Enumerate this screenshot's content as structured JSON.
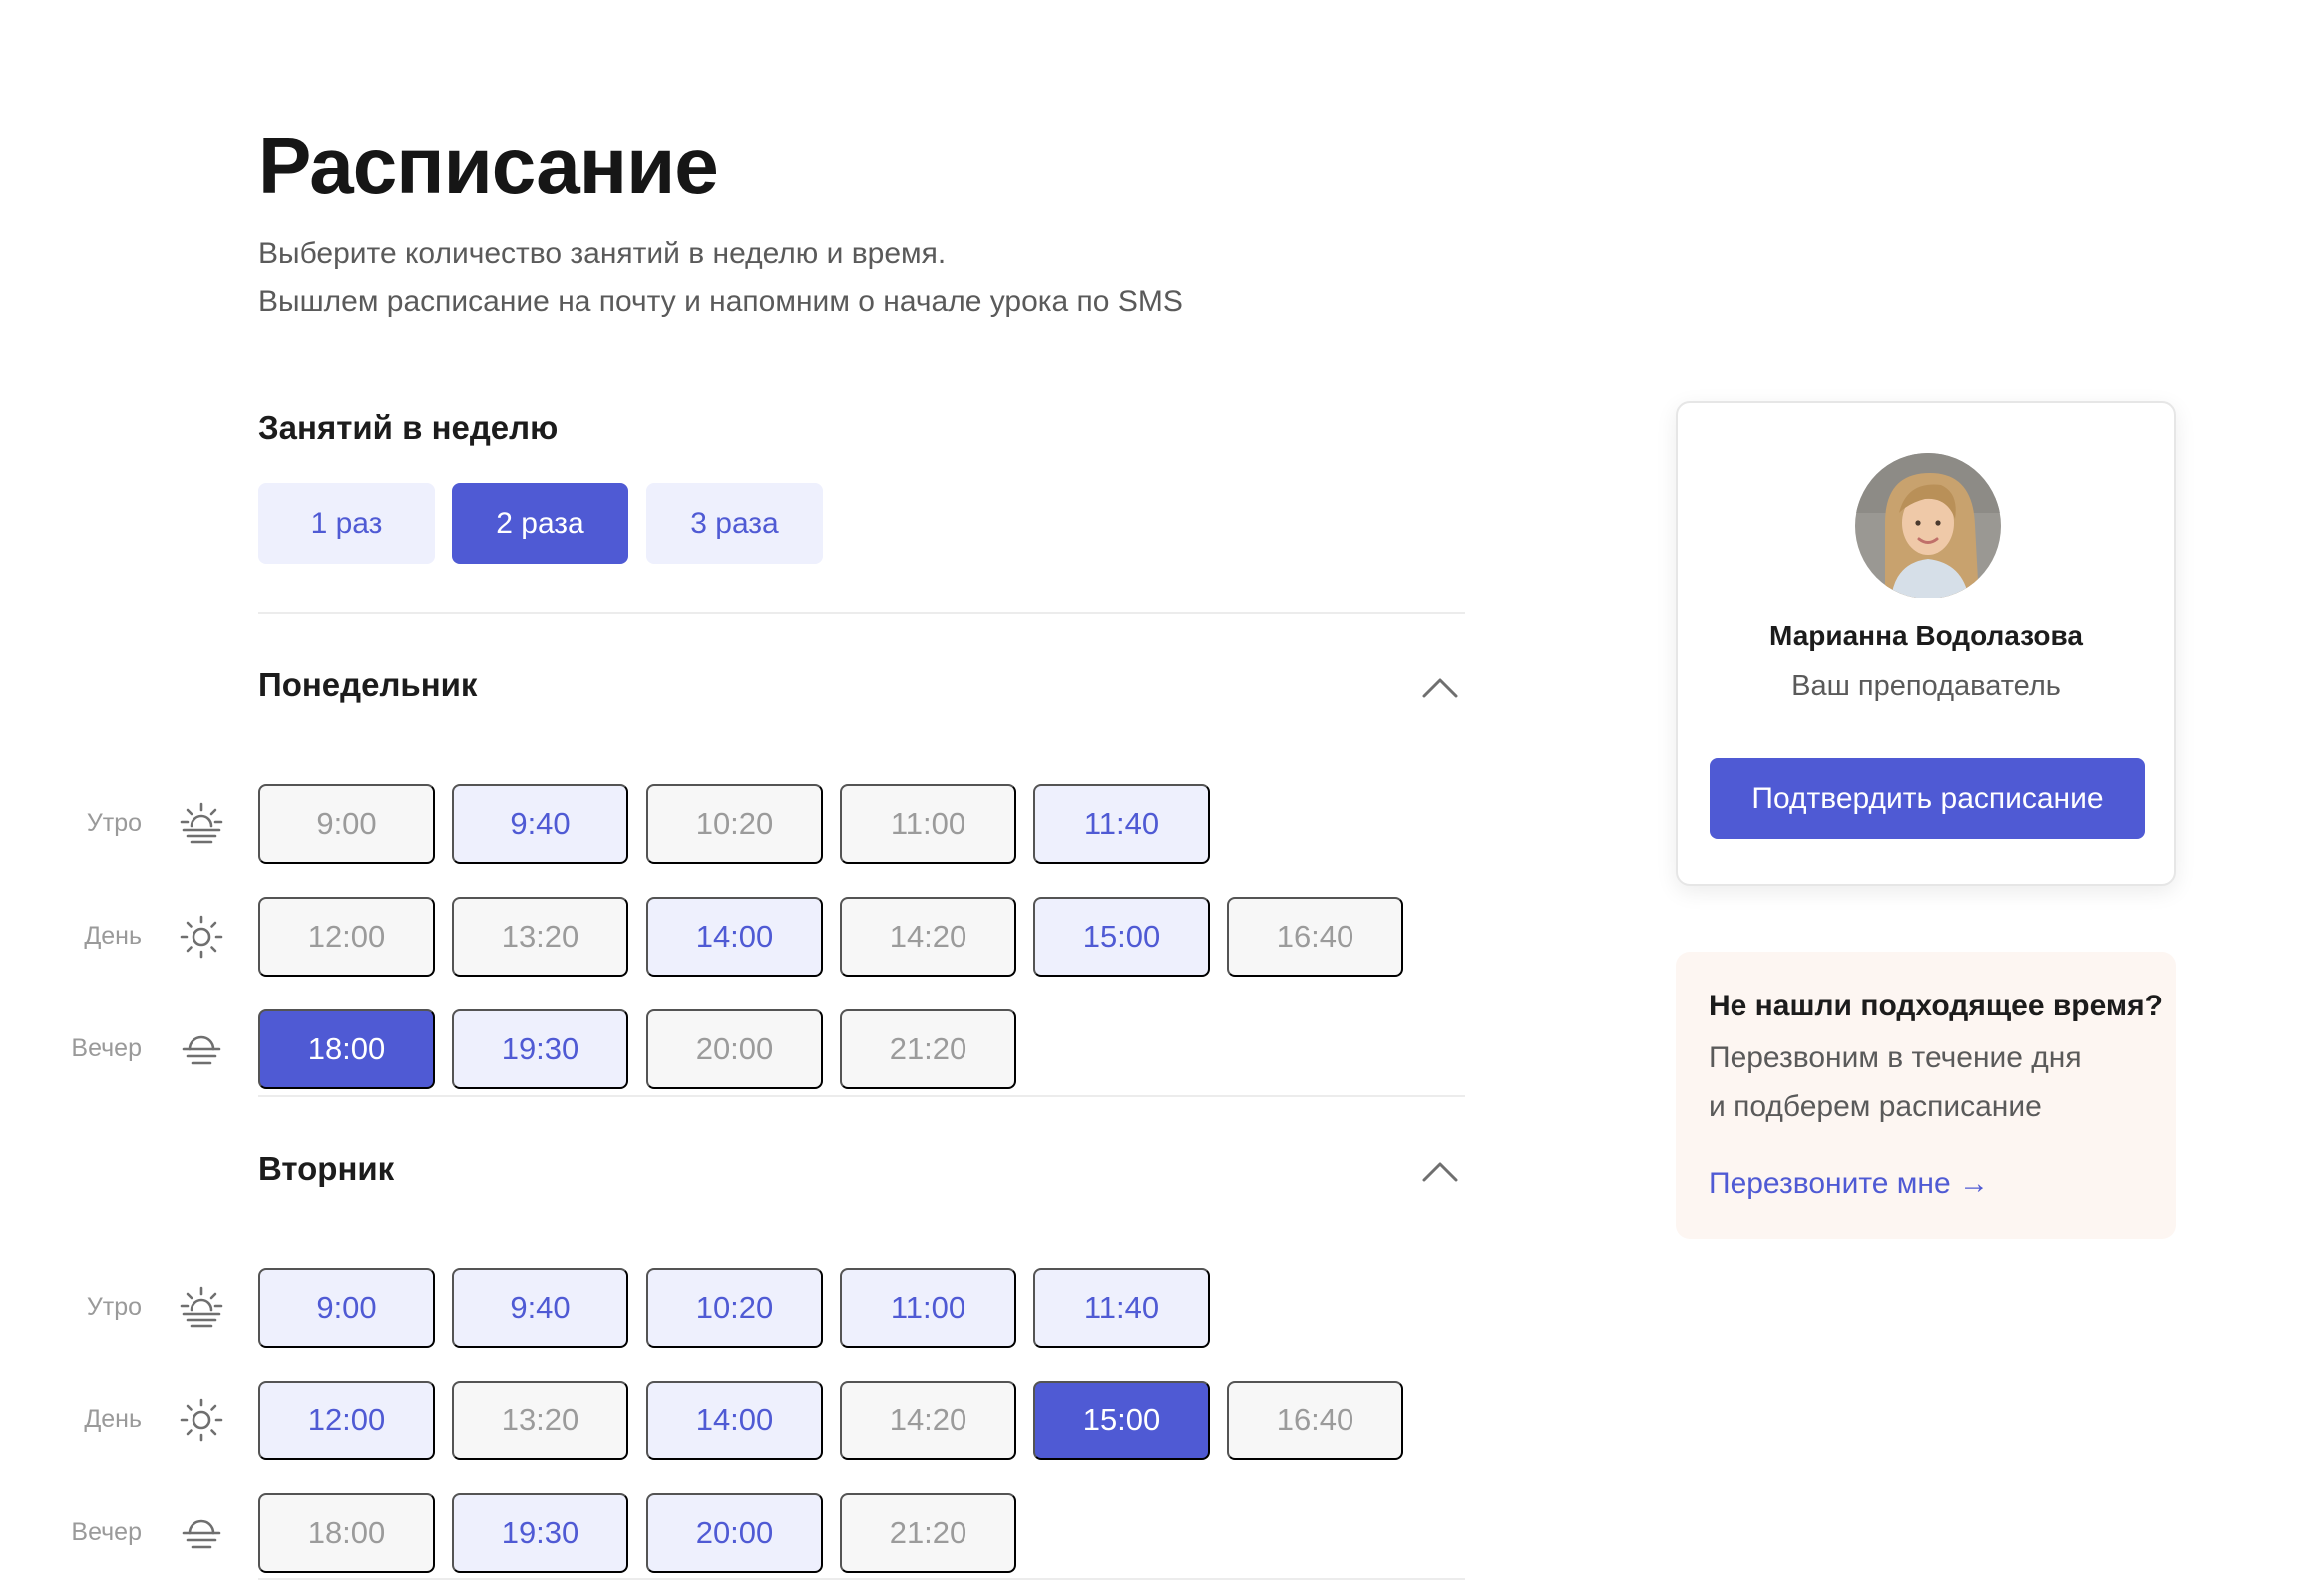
{
  "page": {
    "title": "Расписание",
    "subtitle_line1": "Выберите количество занятий в неделю и время.",
    "subtitle_line2": "Вышлем расписание на почту и напомним о начале урока по SMS"
  },
  "frequency": {
    "title": "Занятий в неделю",
    "options": [
      "1 раз",
      "2 раза",
      "3 раза"
    ],
    "selected": "2 раза"
  },
  "periods": {
    "morning": "Утро",
    "day": "День",
    "evening": "Вечер"
  },
  "days": [
    {
      "name": "Понедельник",
      "morning": [
        {
          "time": "9:00",
          "state": "na"
        },
        {
          "time": "9:40",
          "state": "av"
        },
        {
          "time": "10:20",
          "state": "na"
        },
        {
          "time": "11:00",
          "state": "na"
        },
        {
          "time": "11:40",
          "state": "av"
        }
      ],
      "day": [
        {
          "time": "12:00",
          "state": "na"
        },
        {
          "time": "13:20",
          "state": "na"
        },
        {
          "time": "14:00",
          "state": "av"
        },
        {
          "time": "14:20",
          "state": "na"
        },
        {
          "time": "15:00",
          "state": "av"
        },
        {
          "time": "16:40",
          "state": "na"
        }
      ],
      "evening": [
        {
          "time": "18:00",
          "state": "sel"
        },
        {
          "time": "19:30",
          "state": "av"
        },
        {
          "time": "20:00",
          "state": "na"
        },
        {
          "time": "21:20",
          "state": "na"
        }
      ]
    },
    {
      "name": "Вторник",
      "morning": [
        {
          "time": "9:00",
          "state": "av"
        },
        {
          "time": "9:40",
          "state": "av"
        },
        {
          "time": "10:20",
          "state": "av"
        },
        {
          "time": "11:00",
          "state": "av"
        },
        {
          "time": "11:40",
          "state": "av"
        }
      ],
      "day": [
        {
          "time": "12:00",
          "state": "av"
        },
        {
          "time": "13:20",
          "state": "na"
        },
        {
          "time": "14:00",
          "state": "av"
        },
        {
          "time": "14:20",
          "state": "na"
        },
        {
          "time": "15:00",
          "state": "sel"
        },
        {
          "time": "16:40",
          "state": "na"
        }
      ],
      "evening": [
        {
          "time": "18:00",
          "state": "na"
        },
        {
          "time": "19:30",
          "state": "av"
        },
        {
          "time": "20:00",
          "state": "av"
        },
        {
          "time": "21:20",
          "state": "na"
        }
      ]
    }
  ],
  "teacher": {
    "name": "Марианна Водолазова",
    "role": "Ваш преподаватель",
    "confirm_label": "Подтвердить расписание"
  },
  "callback": {
    "title": "Не нашли подходящее время?",
    "line1": "Перезвоним в течение дня",
    "line2": "и подберем расписание",
    "link": "Перезвоните мне →"
  },
  "colors": {
    "accent": "#4f5ad4",
    "accent_light": "#eef0fd",
    "unavailable": "#f7f7f7",
    "callback_bg": "#fdf6f2"
  },
  "icons": {
    "morning": "sunrise-icon",
    "day": "sun-icon",
    "evening": "sunset-icon",
    "collapse": "chevron-up-icon"
  }
}
